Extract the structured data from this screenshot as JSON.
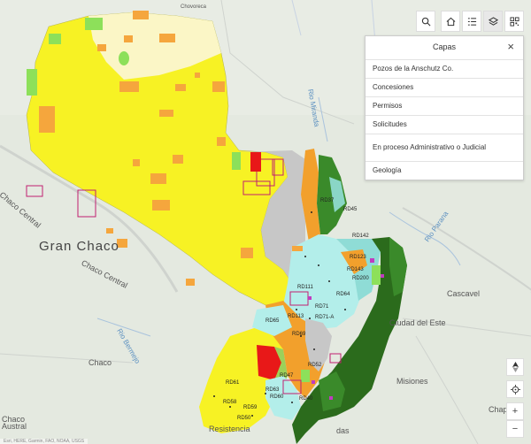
{
  "toolbar": {
    "icons": [
      "search-icon",
      "home-icon",
      "legend-icon",
      "layers-icon",
      "qr-icon"
    ]
  },
  "panel": {
    "title": "Capas",
    "close": "×",
    "items": [
      {
        "label": "Pozos de la Anschutz Co."
      },
      {
        "label": "Concesiones"
      },
      {
        "label": "Permisos"
      },
      {
        "label": "Solicitudes"
      },
      {
        "label": "En proceso Administrativo o Judicial"
      },
      {
        "label": "Geología"
      }
    ]
  },
  "places": {
    "gran_chaco": "Gran Chaco",
    "chaco_central_1": "Chaco Central",
    "chaco_central_2": "Chaco Central",
    "chaco": "Chaco",
    "chaco_austral": "Chaco Austral",
    "cascavel": "Cascavel",
    "ciudad_del_este": "Ciudad del Este",
    "misiones": "Misiones",
    "chapeco": "Chape",
    "resistencia": "Resistencia",
    "chovoreca": "Chovoreca",
    "lomas": "das"
  },
  "rivers": {
    "miranda": "Rio Miranda",
    "parana": "Rio Parana",
    "bermejo": "Rio Bermejo"
  },
  "codes": [
    "RD142",
    "RD143",
    "RD200",
    "RD64",
    "RD113",
    "RD71",
    "RD60",
    "RD61",
    "RD58",
    "RD59",
    "RD47",
    "RD40",
    "RD69",
    "RD65",
    "RD50",
    "RD63",
    "RD37",
    "RD71-A",
    "RD52",
    "RD45",
    "RD111",
    "RD123"
  ],
  "controls": {
    "zoom_in": "+",
    "zoom_out": "−"
  },
  "attribution": "Esri, HERE, Garmin, FAO, NOAA, USGS"
}
